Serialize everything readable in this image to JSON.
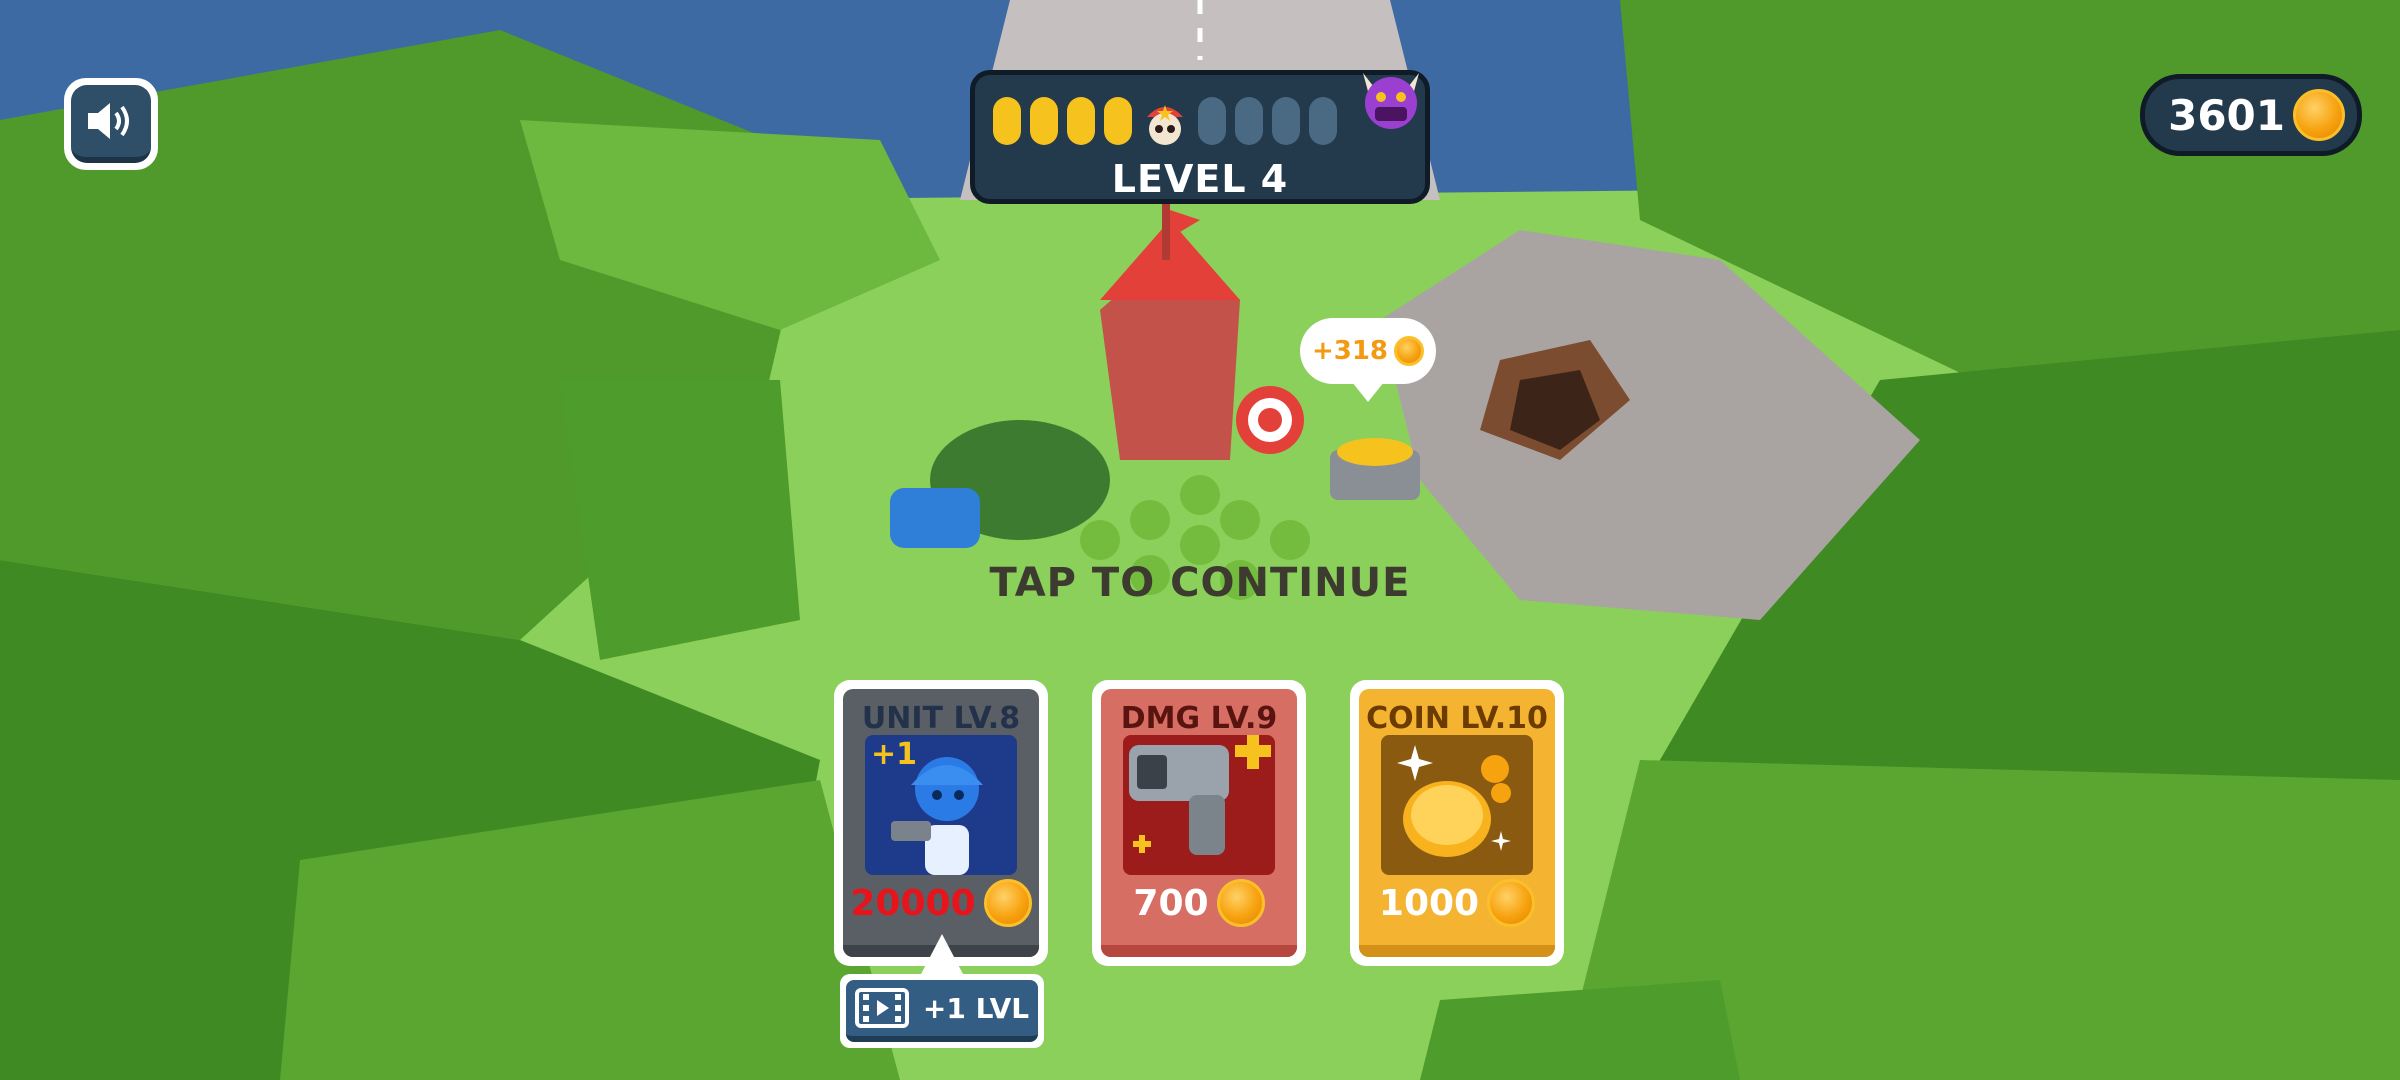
{
  "hud": {
    "sound_icon": "speaker-volume-icon",
    "level_label": "LEVEL 4",
    "stage_progress": {
      "completed": 4,
      "total": 8
    },
    "coins": "3601"
  },
  "mine": {
    "reward_text": "+318"
  },
  "prompt": "TAP TO CONTINUE",
  "cards": [
    {
      "title": "UNIT LV.8",
      "price": "20000",
      "badge": "+1",
      "color": "#5a5f66",
      "price_color": "#e8141c"
    },
    {
      "title": "DMG LV.9",
      "price": "700",
      "color": "#d76e63",
      "price_color": "#ffffff"
    },
    {
      "title": "COIN LV.10",
      "price": "1000",
      "color": "#f4b431",
      "price_color": "#ffffff"
    }
  ],
  "ad_button": {
    "label": "+1 LVL",
    "icon": "video-film-icon"
  }
}
